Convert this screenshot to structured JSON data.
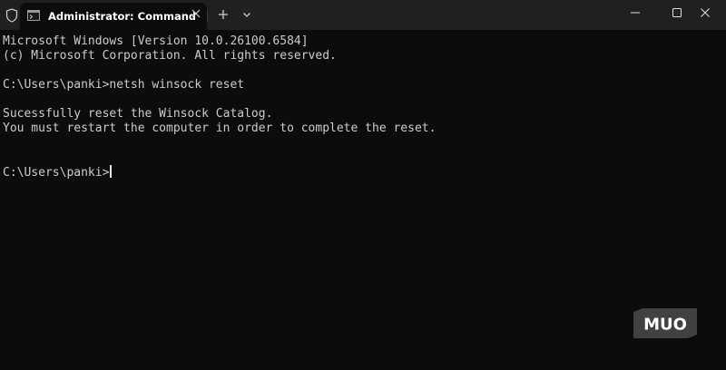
{
  "titlebar": {
    "tab_title": "Administrator: Command Pro",
    "icons": {
      "shield": "shield-icon",
      "terminal": "terminal-icon",
      "close_tab": "close-icon",
      "new_tab": "plus-icon",
      "dropdown": "chevron-down-icon",
      "minimize": "minimize-icon",
      "maximize": "maximize-icon",
      "close_window": "close-icon"
    }
  },
  "terminal": {
    "lines": [
      "Microsoft Windows [Version 10.0.26100.6584]",
      "(c) Microsoft Corporation. All rights reserved.",
      "",
      "C:\\Users\\panki>netsh winsock reset",
      "",
      "Sucessfully reset the Winsock Catalog.",
      "You must restart the computer in order to complete the reset.",
      "",
      "",
      "C:\\Users\\panki>"
    ]
  },
  "watermark": {
    "text": "MUO"
  },
  "colors": {
    "titlebar_bg": "#202020",
    "terminal_bg": "#0c0c0c",
    "text": "#cccccc"
  }
}
